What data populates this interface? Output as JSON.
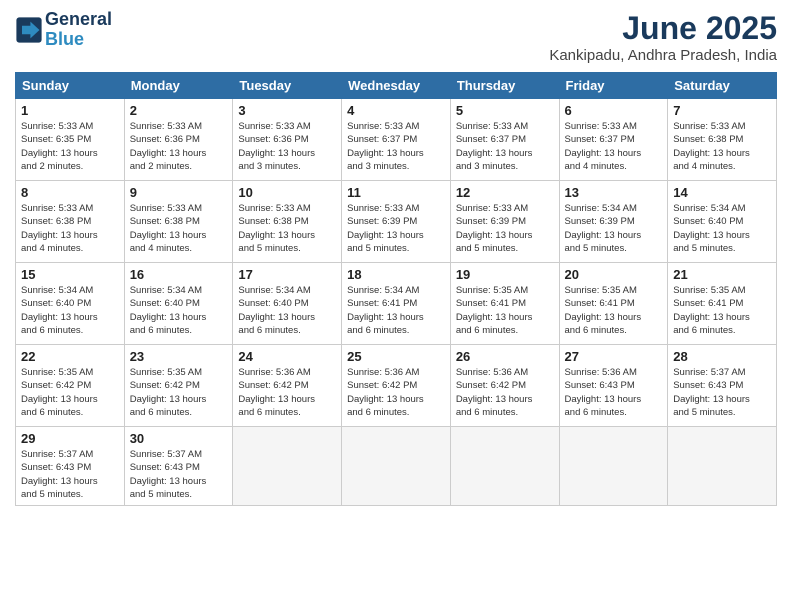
{
  "header": {
    "logo_line1": "General",
    "logo_line2": "Blue",
    "title": "June 2025",
    "subtitle": "Kankipadu, Andhra Pradesh, India"
  },
  "weekdays": [
    "Sunday",
    "Monday",
    "Tuesday",
    "Wednesday",
    "Thursday",
    "Friday",
    "Saturday"
  ],
  "weeks": [
    [
      {
        "day": "1",
        "lines": [
          "Sunrise: 5:33 AM",
          "Sunset: 6:35 PM",
          "Daylight: 13 hours",
          "and 2 minutes."
        ]
      },
      {
        "day": "2",
        "lines": [
          "Sunrise: 5:33 AM",
          "Sunset: 6:36 PM",
          "Daylight: 13 hours",
          "and 2 minutes."
        ]
      },
      {
        "day": "3",
        "lines": [
          "Sunrise: 5:33 AM",
          "Sunset: 6:36 PM",
          "Daylight: 13 hours",
          "and 3 minutes."
        ]
      },
      {
        "day": "4",
        "lines": [
          "Sunrise: 5:33 AM",
          "Sunset: 6:37 PM",
          "Daylight: 13 hours",
          "and 3 minutes."
        ]
      },
      {
        "day": "5",
        "lines": [
          "Sunrise: 5:33 AM",
          "Sunset: 6:37 PM",
          "Daylight: 13 hours",
          "and 3 minutes."
        ]
      },
      {
        "day": "6",
        "lines": [
          "Sunrise: 5:33 AM",
          "Sunset: 6:37 PM",
          "Daylight: 13 hours",
          "and 4 minutes."
        ]
      },
      {
        "day": "7",
        "lines": [
          "Sunrise: 5:33 AM",
          "Sunset: 6:38 PM",
          "Daylight: 13 hours",
          "and 4 minutes."
        ]
      }
    ],
    [
      {
        "day": "8",
        "lines": [
          "Sunrise: 5:33 AM",
          "Sunset: 6:38 PM",
          "Daylight: 13 hours",
          "and 4 minutes."
        ]
      },
      {
        "day": "9",
        "lines": [
          "Sunrise: 5:33 AM",
          "Sunset: 6:38 PM",
          "Daylight: 13 hours",
          "and 4 minutes."
        ]
      },
      {
        "day": "10",
        "lines": [
          "Sunrise: 5:33 AM",
          "Sunset: 6:38 PM",
          "Daylight: 13 hours",
          "and 5 minutes."
        ]
      },
      {
        "day": "11",
        "lines": [
          "Sunrise: 5:33 AM",
          "Sunset: 6:39 PM",
          "Daylight: 13 hours",
          "and 5 minutes."
        ]
      },
      {
        "day": "12",
        "lines": [
          "Sunrise: 5:33 AM",
          "Sunset: 6:39 PM",
          "Daylight: 13 hours",
          "and 5 minutes."
        ]
      },
      {
        "day": "13",
        "lines": [
          "Sunrise: 5:34 AM",
          "Sunset: 6:39 PM",
          "Daylight: 13 hours",
          "and 5 minutes."
        ]
      },
      {
        "day": "14",
        "lines": [
          "Sunrise: 5:34 AM",
          "Sunset: 6:40 PM",
          "Daylight: 13 hours",
          "and 5 minutes."
        ]
      }
    ],
    [
      {
        "day": "15",
        "lines": [
          "Sunrise: 5:34 AM",
          "Sunset: 6:40 PM",
          "Daylight: 13 hours",
          "and 6 minutes."
        ]
      },
      {
        "day": "16",
        "lines": [
          "Sunrise: 5:34 AM",
          "Sunset: 6:40 PM",
          "Daylight: 13 hours",
          "and 6 minutes."
        ]
      },
      {
        "day": "17",
        "lines": [
          "Sunrise: 5:34 AM",
          "Sunset: 6:40 PM",
          "Daylight: 13 hours",
          "and 6 minutes."
        ]
      },
      {
        "day": "18",
        "lines": [
          "Sunrise: 5:34 AM",
          "Sunset: 6:41 PM",
          "Daylight: 13 hours",
          "and 6 minutes."
        ]
      },
      {
        "day": "19",
        "lines": [
          "Sunrise: 5:35 AM",
          "Sunset: 6:41 PM",
          "Daylight: 13 hours",
          "and 6 minutes."
        ]
      },
      {
        "day": "20",
        "lines": [
          "Sunrise: 5:35 AM",
          "Sunset: 6:41 PM",
          "Daylight: 13 hours",
          "and 6 minutes."
        ]
      },
      {
        "day": "21",
        "lines": [
          "Sunrise: 5:35 AM",
          "Sunset: 6:41 PM",
          "Daylight: 13 hours",
          "and 6 minutes."
        ]
      }
    ],
    [
      {
        "day": "22",
        "lines": [
          "Sunrise: 5:35 AM",
          "Sunset: 6:42 PM",
          "Daylight: 13 hours",
          "and 6 minutes."
        ]
      },
      {
        "day": "23",
        "lines": [
          "Sunrise: 5:35 AM",
          "Sunset: 6:42 PM",
          "Daylight: 13 hours",
          "and 6 minutes."
        ]
      },
      {
        "day": "24",
        "lines": [
          "Sunrise: 5:36 AM",
          "Sunset: 6:42 PM",
          "Daylight: 13 hours",
          "and 6 minutes."
        ]
      },
      {
        "day": "25",
        "lines": [
          "Sunrise: 5:36 AM",
          "Sunset: 6:42 PM",
          "Daylight: 13 hours",
          "and 6 minutes."
        ]
      },
      {
        "day": "26",
        "lines": [
          "Sunrise: 5:36 AM",
          "Sunset: 6:42 PM",
          "Daylight: 13 hours",
          "and 6 minutes."
        ]
      },
      {
        "day": "27",
        "lines": [
          "Sunrise: 5:36 AM",
          "Sunset: 6:43 PM",
          "Daylight: 13 hours",
          "and 6 minutes."
        ]
      },
      {
        "day": "28",
        "lines": [
          "Sunrise: 5:37 AM",
          "Sunset: 6:43 PM",
          "Daylight: 13 hours",
          "and 5 minutes."
        ]
      }
    ],
    [
      {
        "day": "29",
        "lines": [
          "Sunrise: 5:37 AM",
          "Sunset: 6:43 PM",
          "Daylight: 13 hours",
          "and 5 minutes."
        ]
      },
      {
        "day": "30",
        "lines": [
          "Sunrise: 5:37 AM",
          "Sunset: 6:43 PM",
          "Daylight: 13 hours",
          "and 5 minutes."
        ]
      },
      null,
      null,
      null,
      null,
      null
    ]
  ]
}
